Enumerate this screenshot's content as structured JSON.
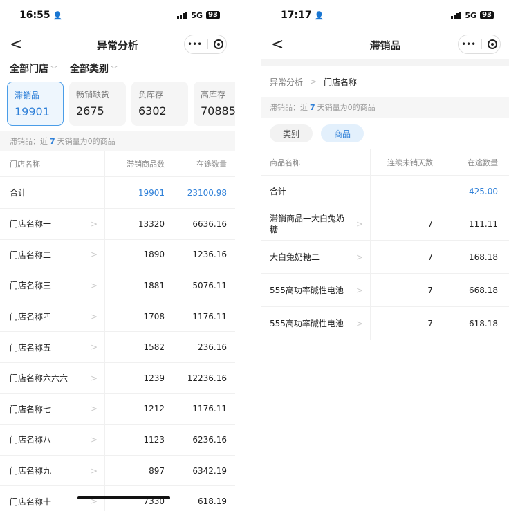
{
  "left": {
    "status": {
      "time": "16:55",
      "signal": "5G",
      "battery": "93"
    },
    "nav": {
      "back": "<",
      "title": "异常分析"
    },
    "filters": [
      "全部门店",
      "全部类别"
    ],
    "cards": [
      {
        "label": "滞销品",
        "value": "19901"
      },
      {
        "label": "畅销缺货",
        "value": "2675"
      },
      {
        "label": "负库存",
        "value": "6302"
      },
      {
        "label": "高库存",
        "value": "70885"
      }
    ],
    "hint": {
      "prefix": "滞销品：近",
      "days": "7",
      "suffix": "天销量为0的商品"
    },
    "table": {
      "headers": [
        "门店名称",
        "滞销商品数",
        "在途数量"
      ],
      "total": {
        "name": "合计",
        "count": "19901",
        "qty": "23100.98"
      },
      "rows": [
        {
          "name": "门店名称一",
          "count": "13320",
          "qty": "6636.16"
        },
        {
          "name": "门店名称二",
          "count": "1890",
          "qty": "1236.16"
        },
        {
          "name": "门店名称三",
          "count": "1881",
          "qty": "5076.11"
        },
        {
          "name": "门店名称四",
          "count": "1708",
          "qty": "1176.11"
        },
        {
          "name": "门店名称五",
          "count": "1582",
          "qty": "236.16"
        },
        {
          "name": "门店名称六六六",
          "count": "1239",
          "qty": "12236.16"
        },
        {
          "name": "门店名称七",
          "count": "1212",
          "qty": "1176.11"
        },
        {
          "name": "门店名称八",
          "count": "1123",
          "qty": "6236.16"
        },
        {
          "name": "门店名称九",
          "count": "897",
          "qty": "6342.19"
        },
        {
          "name": "门店名称十",
          "count": "7330",
          "qty": "618.19"
        }
      ]
    }
  },
  "right": {
    "status": {
      "time": "17:17",
      "signal": "5G",
      "battery": "93"
    },
    "nav": {
      "back": "<",
      "title": "滞销品"
    },
    "breadcrumb": {
      "parent": "异常分析",
      "sep": ">",
      "current": "门店名称一"
    },
    "hint": {
      "prefix": "滞销品：近",
      "days": "7",
      "suffix": "天销量为0的商品"
    },
    "tabs": [
      {
        "label": "类别",
        "active": false
      },
      {
        "label": "商品",
        "active": true
      }
    ],
    "table": {
      "headers": [
        "商品名称",
        "连续未销天数",
        "在途数量"
      ],
      "total": {
        "name": "合计",
        "days": "-",
        "qty": "425.00"
      },
      "rows": [
        {
          "name": "滞销商品一大白兔奶糖",
          "days": "7",
          "qty": "111.11"
        },
        {
          "name": "大白兔奶糖二",
          "days": "7",
          "qty": "168.18"
        },
        {
          "name": "555高功率碱性电池",
          "days": "7",
          "qty": "668.18"
        },
        {
          "name": "555高功率碱性电池",
          "days": "7",
          "qty": "618.18"
        }
      ]
    }
  }
}
